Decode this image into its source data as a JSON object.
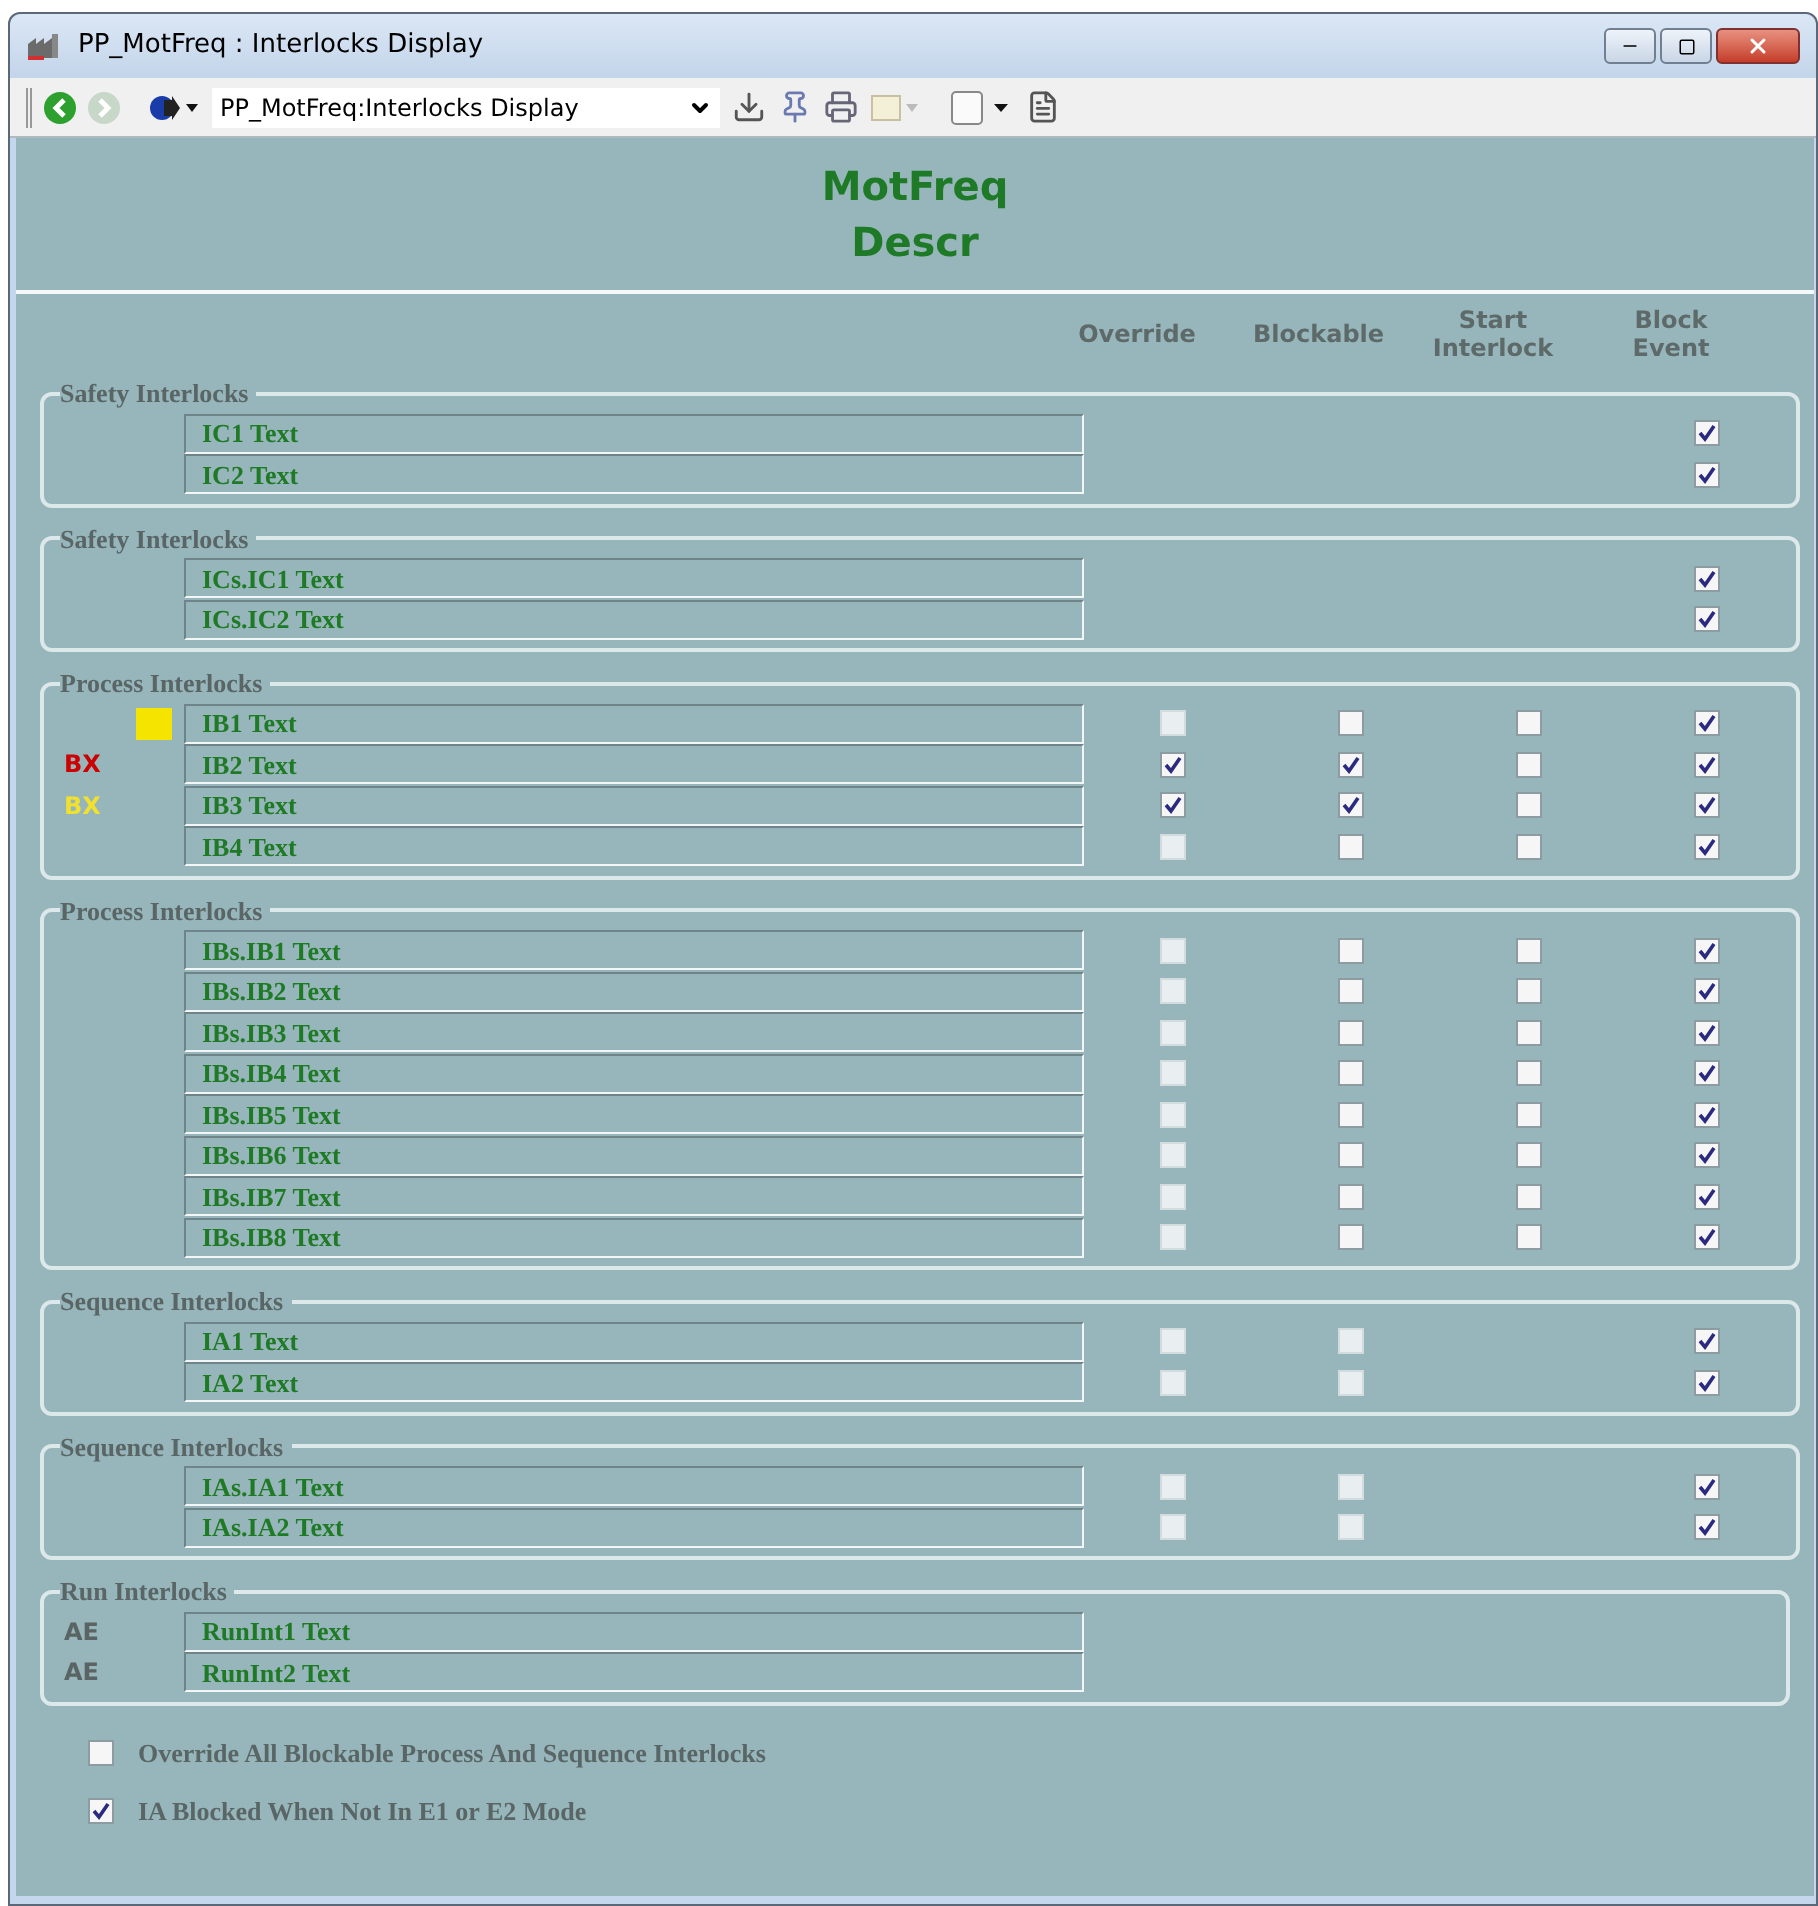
{
  "window": {
    "title": "PP_MotFreq : Interlocks Display"
  },
  "toolbar": {
    "address": "PP_MotFreq:Interlocks Display"
  },
  "header": {
    "title": "MotFreq",
    "subtitle": "Descr"
  },
  "columns": [
    "Override",
    "Blockable",
    "Start Interlock",
    "Block Event"
  ],
  "groups": [
    {
      "label": "Safety Interlocks",
      "rows": [
        {
          "text": "IC1 Text",
          "cells": [
            null,
            null,
            null,
            {
              "checked": true,
              "disabled": false
            }
          ]
        },
        {
          "text": "IC2 Text",
          "cells": [
            null,
            null,
            null,
            {
              "checked": true,
              "disabled": false
            }
          ]
        }
      ]
    },
    {
      "label": "Safety Interlocks",
      "rows": [
        {
          "text": "ICs.IC1 Text",
          "cells": [
            null,
            null,
            null,
            {
              "checked": true,
              "disabled": false
            }
          ]
        },
        {
          "text": "ICs.IC2 Text",
          "cells": [
            null,
            null,
            null,
            {
              "checked": true,
              "disabled": false
            }
          ]
        }
      ]
    },
    {
      "label": "Process Interlocks",
      "rows": [
        {
          "tag": {
            "kind": "swatch",
            "color": "#f5e400"
          },
          "text": "IB1 Text",
          "cells": [
            {
              "checked": false,
              "disabled": true
            },
            {
              "checked": false,
              "disabled": false
            },
            {
              "checked": false,
              "disabled": false
            },
            {
              "checked": true,
              "disabled": false
            }
          ]
        },
        {
          "tag": {
            "kind": "text",
            "text": "BX",
            "color": "#cc0000"
          },
          "text": "IB2 Text",
          "cells": [
            {
              "checked": true,
              "disabled": false
            },
            {
              "checked": true,
              "disabled": false
            },
            {
              "checked": false,
              "disabled": false
            },
            {
              "checked": true,
              "disabled": false
            }
          ]
        },
        {
          "tag": {
            "kind": "text",
            "text": "BX",
            "color": "#f0e030"
          },
          "text": "IB3 Text",
          "cells": [
            {
              "checked": true,
              "disabled": false
            },
            {
              "checked": true,
              "disabled": false
            },
            {
              "checked": false,
              "disabled": false
            },
            {
              "checked": true,
              "disabled": false
            }
          ]
        },
        {
          "text": "IB4 Text",
          "cells": [
            {
              "checked": false,
              "disabled": true
            },
            {
              "checked": false,
              "disabled": false
            },
            {
              "checked": false,
              "disabled": false
            },
            {
              "checked": true,
              "disabled": false
            }
          ]
        }
      ]
    },
    {
      "label": "Process Interlocks",
      "rows": [
        {
          "text": "IBs.IB1 Text",
          "cells": [
            {
              "checked": false,
              "disabled": true
            },
            {
              "checked": false,
              "disabled": false
            },
            {
              "checked": false,
              "disabled": false
            },
            {
              "checked": true,
              "disabled": false
            }
          ]
        },
        {
          "text": "IBs.IB2 Text",
          "cells": [
            {
              "checked": false,
              "disabled": true
            },
            {
              "checked": false,
              "disabled": false
            },
            {
              "checked": false,
              "disabled": false
            },
            {
              "checked": true,
              "disabled": false
            }
          ]
        },
        {
          "text": "IBs.IB3 Text",
          "cells": [
            {
              "checked": false,
              "disabled": true
            },
            {
              "checked": false,
              "disabled": false
            },
            {
              "checked": false,
              "disabled": false
            },
            {
              "checked": true,
              "disabled": false
            }
          ]
        },
        {
          "text": "IBs.IB4 Text",
          "cells": [
            {
              "checked": false,
              "disabled": true
            },
            {
              "checked": false,
              "disabled": false
            },
            {
              "checked": false,
              "disabled": false
            },
            {
              "checked": true,
              "disabled": false
            }
          ]
        },
        {
          "text": "IBs.IB5 Text",
          "cells": [
            {
              "checked": false,
              "disabled": true
            },
            {
              "checked": false,
              "disabled": false
            },
            {
              "checked": false,
              "disabled": false
            },
            {
              "checked": true,
              "disabled": false
            }
          ]
        },
        {
          "text": "IBs.IB6 Text",
          "cells": [
            {
              "checked": false,
              "disabled": true
            },
            {
              "checked": false,
              "disabled": false
            },
            {
              "checked": false,
              "disabled": false
            },
            {
              "checked": true,
              "disabled": false
            }
          ]
        },
        {
          "text": "IBs.IB7 Text",
          "cells": [
            {
              "checked": false,
              "disabled": true
            },
            {
              "checked": false,
              "disabled": false
            },
            {
              "checked": false,
              "disabled": false
            },
            {
              "checked": true,
              "disabled": false
            }
          ]
        },
        {
          "text": "IBs.IB8 Text",
          "cells": [
            {
              "checked": false,
              "disabled": true
            },
            {
              "checked": false,
              "disabled": false
            },
            {
              "checked": false,
              "disabled": false
            },
            {
              "checked": true,
              "disabled": false
            }
          ]
        }
      ]
    },
    {
      "label": "Sequence Interlocks",
      "rows": [
        {
          "text": "IA1 Text",
          "cells": [
            {
              "checked": false,
              "disabled": true
            },
            {
              "checked": false,
              "disabled": true
            },
            null,
            {
              "checked": true,
              "disabled": false
            }
          ]
        },
        {
          "text": "IA2 Text",
          "cells": [
            {
              "checked": false,
              "disabled": true
            },
            {
              "checked": false,
              "disabled": true
            },
            null,
            {
              "checked": true,
              "disabled": false
            }
          ]
        }
      ]
    },
    {
      "label": "Sequence Interlocks",
      "rows": [
        {
          "text": "IAs.IA1 Text",
          "cells": [
            {
              "checked": false,
              "disabled": true
            },
            {
              "checked": false,
              "disabled": true
            },
            null,
            {
              "checked": true,
              "disabled": false
            }
          ]
        },
        {
          "text": "IAs.IA2 Text",
          "cells": [
            {
              "checked": false,
              "disabled": true
            },
            {
              "checked": false,
              "disabled": true
            },
            null,
            {
              "checked": true,
              "disabled": false
            }
          ]
        }
      ]
    },
    {
      "label": "Run Interlocks",
      "rows": [
        {
          "tag": {
            "kind": "text",
            "text": "AE",
            "color": "#5a6464"
          },
          "text": "RunInt1 Text"
        },
        {
          "tag": {
            "kind": "text",
            "text": "AE",
            "color": "#5a6464"
          },
          "text": "RunInt2 Text"
        }
      ]
    }
  ],
  "options": [
    {
      "label": "Override All Blockable Process And Sequence Interlocks",
      "checked": false
    },
    {
      "label": "IA Blocked When Not In E1 or E2 Mode",
      "checked": true
    }
  ]
}
